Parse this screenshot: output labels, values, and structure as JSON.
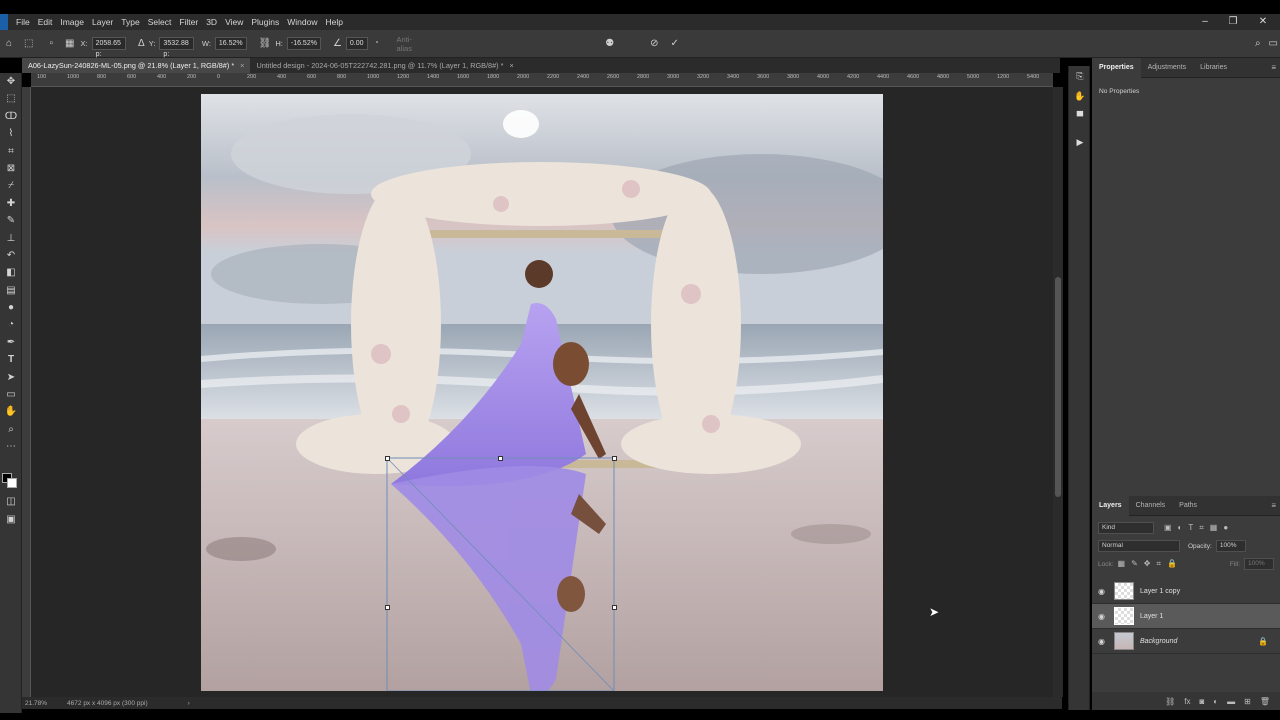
{
  "menubar": {
    "items": [
      "File",
      "Edit",
      "Image",
      "Layer",
      "Type",
      "Select",
      "Filter",
      "3D",
      "View",
      "Plugins",
      "Window",
      "Help"
    ]
  },
  "options": {
    "x_label": "X:",
    "x_value": "2058.65 p:",
    "y_label": "Y:",
    "y_value": "3532.88 p:",
    "w_label": "W:",
    "w_value": "16.52%",
    "h_label": "H:",
    "h_value": "-16.52%",
    "angle_value": "0.00",
    "angle_unit": "°",
    "antialias_label": "Anti-alias"
  },
  "tabs": [
    {
      "label": "A06-LazySun-240826-ML-05.png @ 21.8% (Layer 1, RGB/8#) *",
      "close": "×"
    },
    {
      "label": "Untitled design - 2024-06-05T222742.281.png @ 11.7% (Layer 1, RGB/8#) *",
      "close": "×"
    }
  ],
  "ruler": {
    "h_ticks": [
      "100",
      "1000",
      "800",
      "600",
      "400",
      "200",
      "0",
      "200",
      "400",
      "600",
      "800",
      "1000",
      "1200",
      "1400",
      "1600",
      "1800",
      "2000",
      "2200",
      "2400",
      "2600",
      "2800",
      "3000",
      "3200",
      "3400",
      "3600",
      "3800",
      "4000",
      "4200",
      "4400",
      "4600",
      "4800",
      "5000",
      "1200",
      "5400"
    ]
  },
  "statusbar": {
    "zoom": "21.78%",
    "doc_size": "4672 px x 4096 px (300 ppi)"
  },
  "properties": {
    "tabs": [
      "Properties",
      "Adjustments",
      "Libraries"
    ],
    "empty_text": "No Properties"
  },
  "layers": {
    "tabs": [
      "Layers",
      "Channels",
      "Paths"
    ],
    "kind_placeholder": "Kind",
    "blend_mode": "Normal",
    "opacity_label": "Opacity:",
    "opacity_value": "100%",
    "lock_label": "Lock:",
    "fill_label": "Fill:",
    "fill_value": "100%",
    "items": [
      {
        "name": "Layer 1 copy",
        "selected": false
      },
      {
        "name": "Layer 1",
        "selected": true
      },
      {
        "name": "Background",
        "selected": false,
        "locked": true
      }
    ]
  },
  "colors": {
    "app_bg": "#2b2b2b",
    "panel_bg": "#3c3c3c",
    "canvas_bg": "#262626",
    "accent_dress": "#a992e8"
  }
}
